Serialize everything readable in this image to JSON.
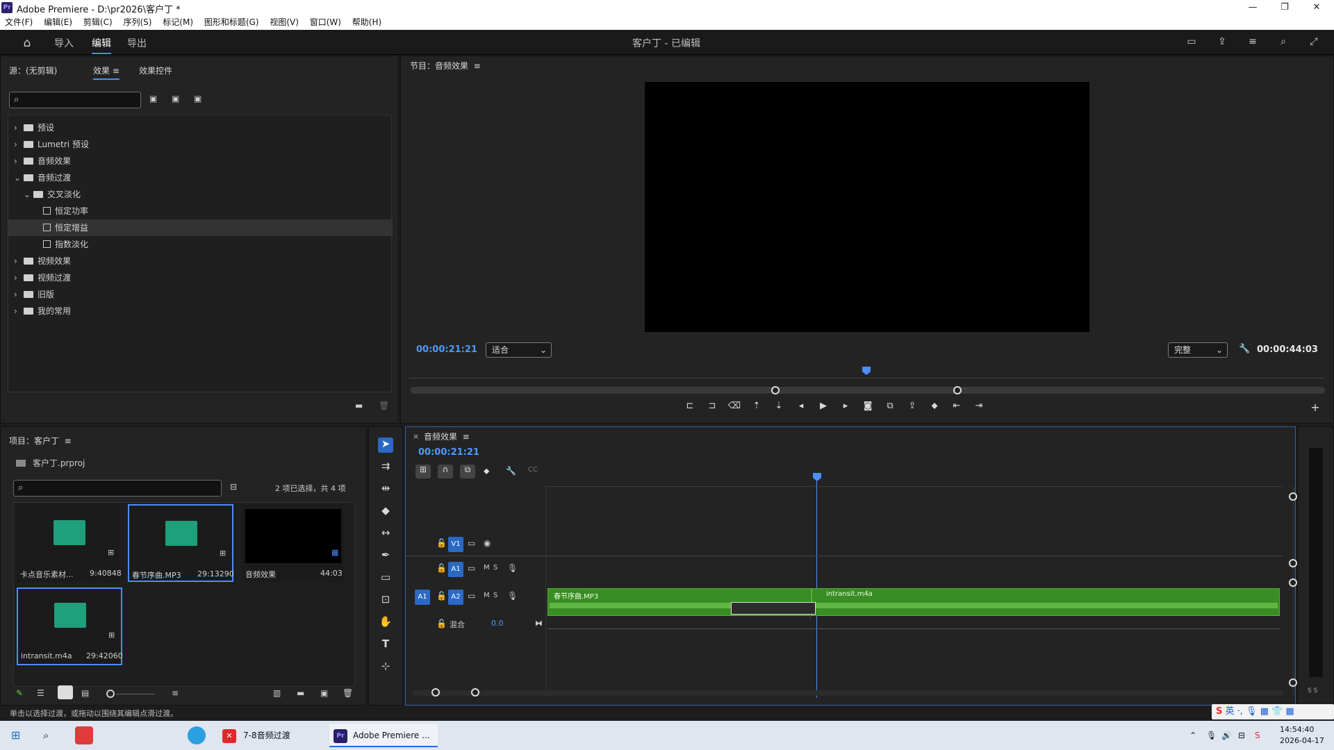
{
  "window": {
    "app": "Pr",
    "title": "Adobe Premiere - D:\\pr2026\\客户丁 *"
  },
  "menu": [
    "文件(F)",
    "编辑(E)",
    "剪辑(C)",
    "序列(S)",
    "标记(M)",
    "图形和标题(G)",
    "视图(V)",
    "窗口(W)",
    "帮助(H)"
  ],
  "header": {
    "tabs": [
      "导入",
      "编辑",
      "导出"
    ],
    "active_tab": "编辑",
    "project_title": "客户丁 - 已编辑"
  },
  "effects_panel": {
    "source_label": "源：(无剪辑)",
    "tab_effects": "效果",
    "tab_effect_controls": "效果控件",
    "tree": [
      {
        "label": "预设",
        "level": 0,
        "kind": "folder",
        "expanded": false
      },
      {
        "label": "Lumetri 预设",
        "level": 0,
        "kind": "folder",
        "expanded": false
      },
      {
        "label": "音频效果",
        "level": 0,
        "kind": "folder",
        "expanded": false
      },
      {
        "label": "音频过渡",
        "level": 0,
        "kind": "folder",
        "expanded": true
      },
      {
        "label": "交叉淡化",
        "level": 1,
        "kind": "folder",
        "expanded": true
      },
      {
        "label": "恒定功率",
        "level": 2,
        "kind": "fx"
      },
      {
        "label": "恒定增益",
        "level": 2,
        "kind": "fx",
        "selected": true
      },
      {
        "label": "指数淡化",
        "level": 2,
        "kind": "fx"
      },
      {
        "label": "视频效果",
        "level": 0,
        "kind": "folder",
        "expanded": false
      },
      {
        "label": "视频过渡",
        "level": 0,
        "kind": "folder",
        "expanded": false
      },
      {
        "label": "旧版",
        "level": 0,
        "kind": "folder",
        "expanded": false
      },
      {
        "label": "我的常用",
        "level": 0,
        "kind": "folder",
        "expanded": false
      }
    ]
  },
  "project_panel": {
    "title": "项目：客户丁",
    "file": "客户丁.prproj",
    "selection_info": "2 项已选择，共 4 项",
    "items": [
      {
        "name": "卡点音乐素材...",
        "duration": "9:40848",
        "kind": "audio",
        "selected": false
      },
      {
        "name": "春节序曲.MP3",
        "duration": "29:13290",
        "kind": "audio",
        "selected": true
      },
      {
        "name": "音频效果",
        "duration": "44:03",
        "kind": "sequence",
        "selected": false
      },
      {
        "name": "intransit.m4a",
        "duration": "29:42060",
        "kind": "audio",
        "selected": true
      }
    ]
  },
  "program_monitor": {
    "title": "节目：音频效果",
    "timecode": "00:00:21:21",
    "fit": "适合",
    "quality": "完整",
    "duration": "00:00:44:03"
  },
  "timeline": {
    "sequence_name": "音频效果",
    "timecode": "00:00:21:21",
    "tracks": {
      "v1": "V1",
      "a1": "A1",
      "a2": "A2",
      "src_a1": "A1",
      "mix_label": "混合",
      "mix_value": "0.0",
      "m": "M",
      "s": "S"
    },
    "clips": [
      {
        "name": "春节序曲.MP3"
      },
      {
        "name": "intransit.m4a"
      }
    ],
    "meter_labels": "S S"
  },
  "status": "单击以选择过渡，或拖动以围绕其编辑点滑过渡。",
  "taskbar": {
    "tasks": [
      "7-8音频过渡",
      "Adobe Premiere ..."
    ],
    "ime": "英",
    "time": "14:54:40",
    "date": "2026-04-17"
  },
  "colors": {
    "accent": "#4c8dff",
    "clip": "#3a8c24",
    "timecode": "#4c9bff"
  }
}
